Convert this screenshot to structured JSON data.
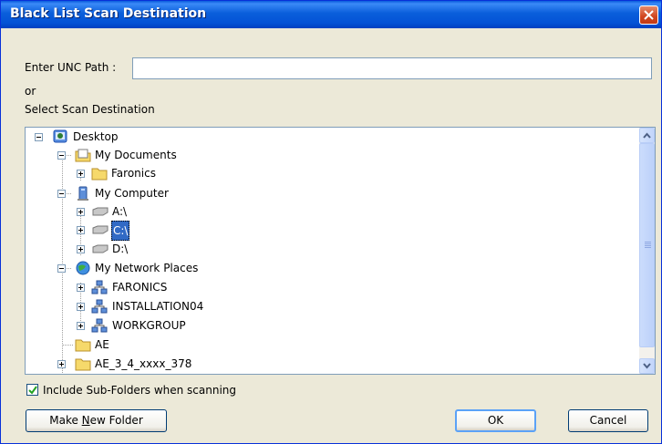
{
  "window": {
    "title": "Black List Scan Destination"
  },
  "form": {
    "unc_label": "Enter UNC Path :",
    "unc_value": "",
    "or_label": "or",
    "select_label": "Select Scan Destination"
  },
  "tree": {
    "desktop": "Desktop",
    "my_documents": "My Documents",
    "faronics_folder": "Faronics",
    "my_computer": "My Computer",
    "drive_a": "A:\\",
    "drive_c": "C:\\",
    "drive_d": "D:\\",
    "network_places": "My Network Places",
    "net_faronics": "FARONICS",
    "net_installation": "INSTALLATION04",
    "net_workgroup": "WORKGROUP",
    "folder_ae": "AE",
    "folder_ae_build": "AE_3_4_xxxx_378",
    "selected": "C:\\"
  },
  "options": {
    "include_subfolders": "Include Sub-Folders when scanning",
    "include_subfolders_checked": true
  },
  "buttons": {
    "make_folder_pre": "Make ",
    "make_folder_mn": "N",
    "make_folder_post": "ew Folder",
    "ok": "OK",
    "cancel": "Cancel"
  },
  "icons": [
    "close-icon",
    "desktop-icon",
    "documents-icon",
    "folder-icon",
    "computer-icon",
    "drive-icon",
    "network-icon",
    "workgroup-icon",
    "checkmark-icon",
    "scroll-up-icon",
    "scroll-down-icon"
  ],
  "colors": {
    "titlebar": "#0453d6",
    "selection": "#316ac5",
    "close": "#d0451e",
    "dialog_bg": "#ece9d8"
  }
}
